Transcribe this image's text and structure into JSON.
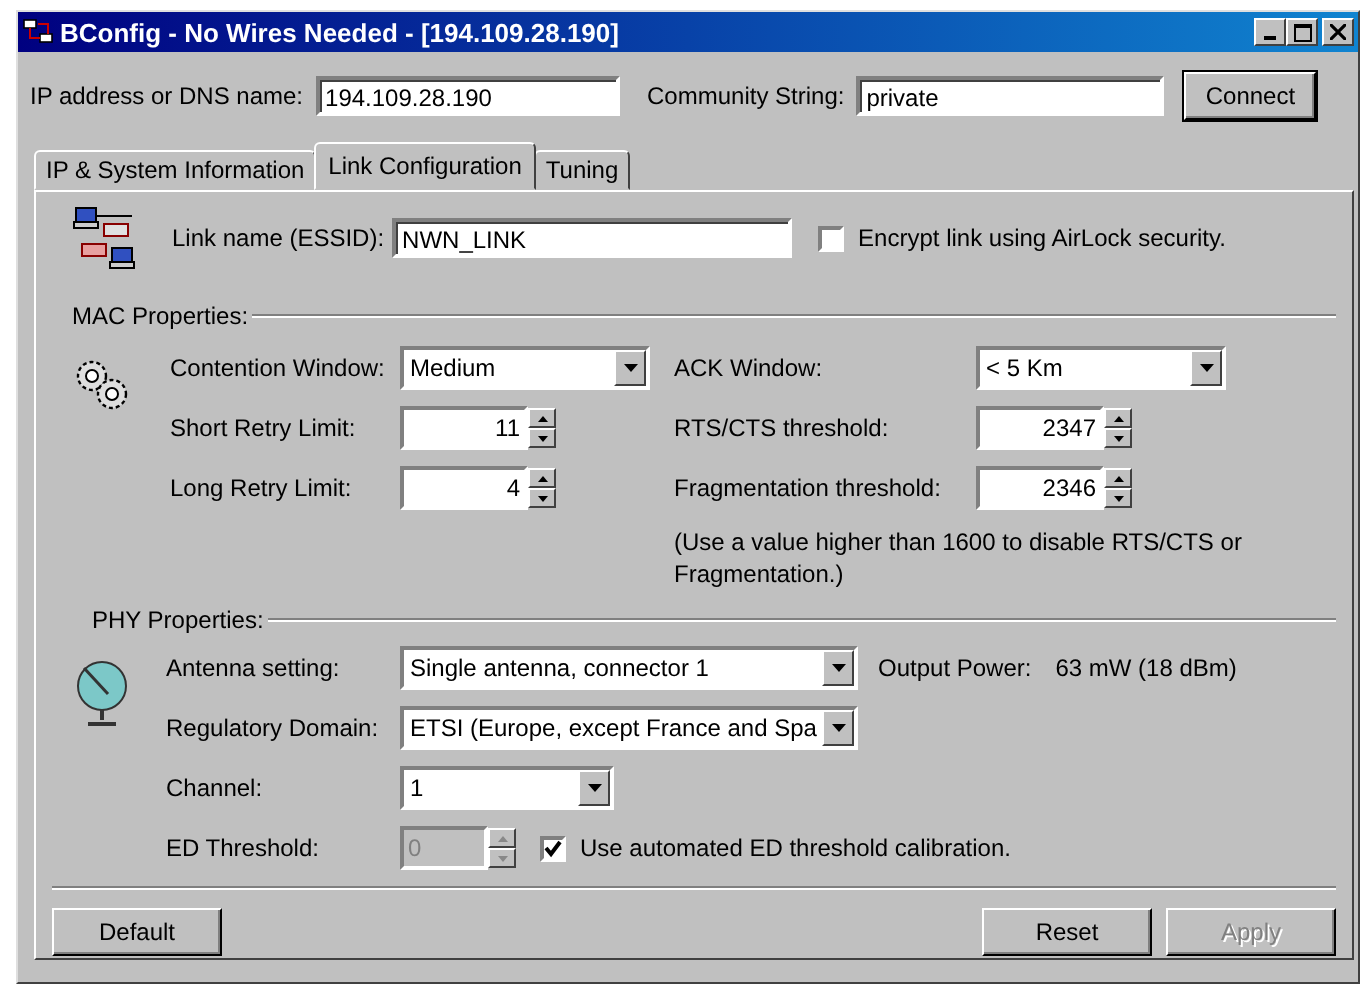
{
  "window": {
    "title": "BConfig - No Wires Needed - [194.109.28.190]"
  },
  "connection": {
    "ip_label": "IP address or DNS name:",
    "ip_value": "194.109.28.190",
    "community_label": "Community String:",
    "community_value": "private",
    "connect_button": "Connect"
  },
  "tabs": [
    {
      "label": "IP & System Information",
      "selected": false
    },
    {
      "label": "Link Configuration",
      "selected": true
    },
    {
      "label": "Tuning",
      "selected": false
    }
  ],
  "link": {
    "label": "Link name (ESSID):",
    "value": "NWN_LINK",
    "encrypt": {
      "label": "Encrypt link using AirLock security.",
      "checked": false
    }
  },
  "mac": {
    "legend": "MAC Properties:",
    "left": [
      {
        "kind": "dropdown",
        "label": "Contention Window:",
        "value": "Medium"
      },
      {
        "kind": "spinner",
        "label": "Short Retry Limit:",
        "value": "11"
      },
      {
        "kind": "spinner",
        "label": "Long Retry Limit:",
        "value": "4"
      }
    ],
    "right": [
      {
        "kind": "dropdown",
        "label": "ACK Window:",
        "value": "< 5 Km"
      },
      {
        "kind": "spinner",
        "label": "RTS/CTS threshold:",
        "value": "2347"
      },
      {
        "kind": "spinner",
        "label": "Fragmentation threshold:",
        "value": "2346"
      }
    ],
    "note": "(Use a value higher than 1600 to disable RTS/CTS or Fragmentation.)"
  },
  "phy": {
    "legend": "PHY Properties:",
    "antenna": {
      "label": "Antenna setting:",
      "value": "Single antenna, connector 1"
    },
    "output_power_label": "Output Power:",
    "output_power_value": "63 mW (18 dBm)",
    "regulatory": {
      "label": "Regulatory Domain:",
      "value": "ETSI (Europe, except France and Spa"
    },
    "channel": {
      "label": "Channel:",
      "value": "1"
    },
    "ed_threshold": {
      "label": "ED Threshold:",
      "value": "0",
      "disabled": true
    },
    "auto_calibration": {
      "label": "Use automated ED threshold calibration.",
      "checked": true
    }
  },
  "buttons": [
    {
      "kind": "left",
      "label": "Default",
      "disabled": false
    },
    {
      "kind": "right",
      "label": "Reset",
      "disabled": false
    },
    {
      "kind": "right",
      "label": "Apply",
      "disabled": true
    }
  ]
}
